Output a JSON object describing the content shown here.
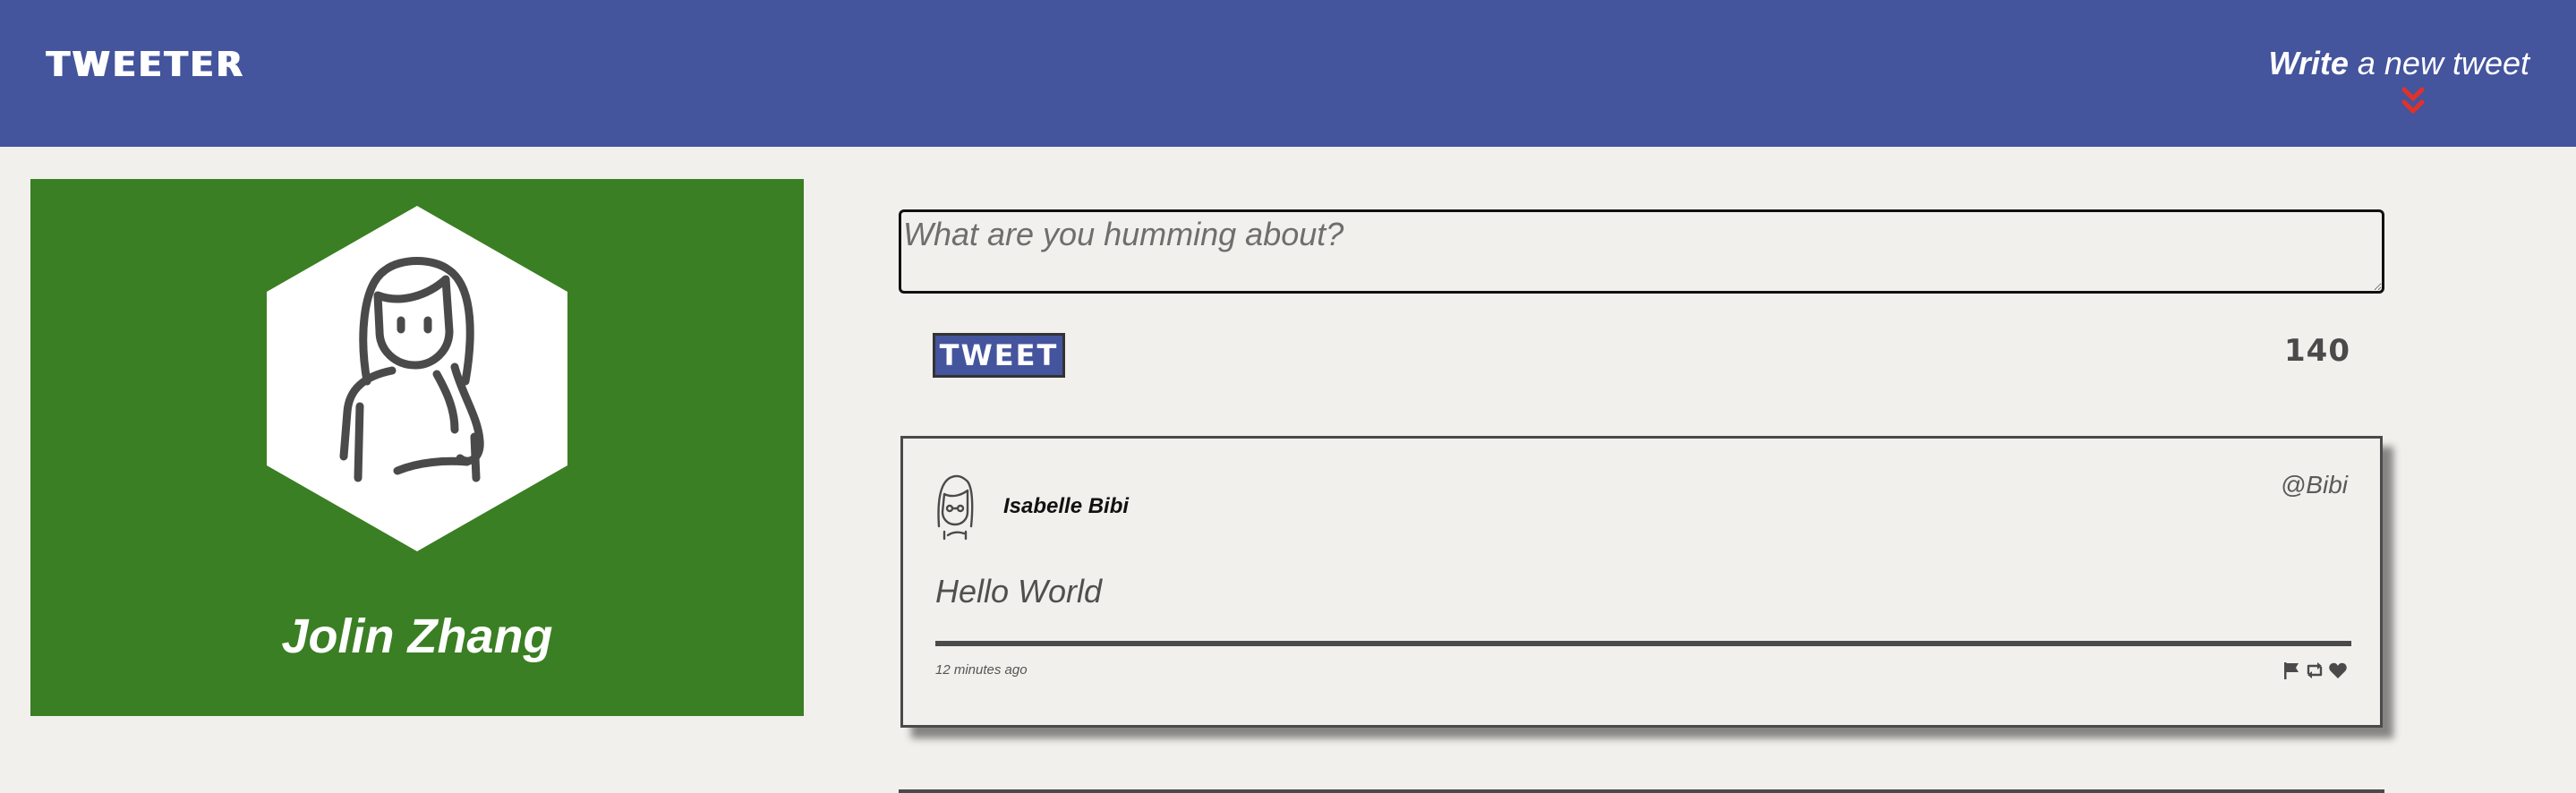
{
  "header": {
    "brand": "TWEETER",
    "compose_toggle": {
      "bold": "Write",
      "rest": " a new tweet",
      "icon": "double-chevron-down-icon",
      "icon_color": "#e0322a"
    },
    "background": "#44549d"
  },
  "profile": {
    "name": "Jolin Zhang",
    "avatar_icon": "user-avatar-icon",
    "card_color": "#3a7f23"
  },
  "composer": {
    "placeholder": "What are you humming about?",
    "value": "",
    "submit_label": "TWEET",
    "char_count": "140"
  },
  "tweets": [
    {
      "author": "Isabelle Bibi",
      "handle": "@Bibi",
      "text": "Hello World",
      "time": "12 minutes ago",
      "avatar_icon": "user-avatar-icon",
      "actions": [
        "flag-icon",
        "retweet-icon",
        "heart-icon"
      ]
    }
  ]
}
